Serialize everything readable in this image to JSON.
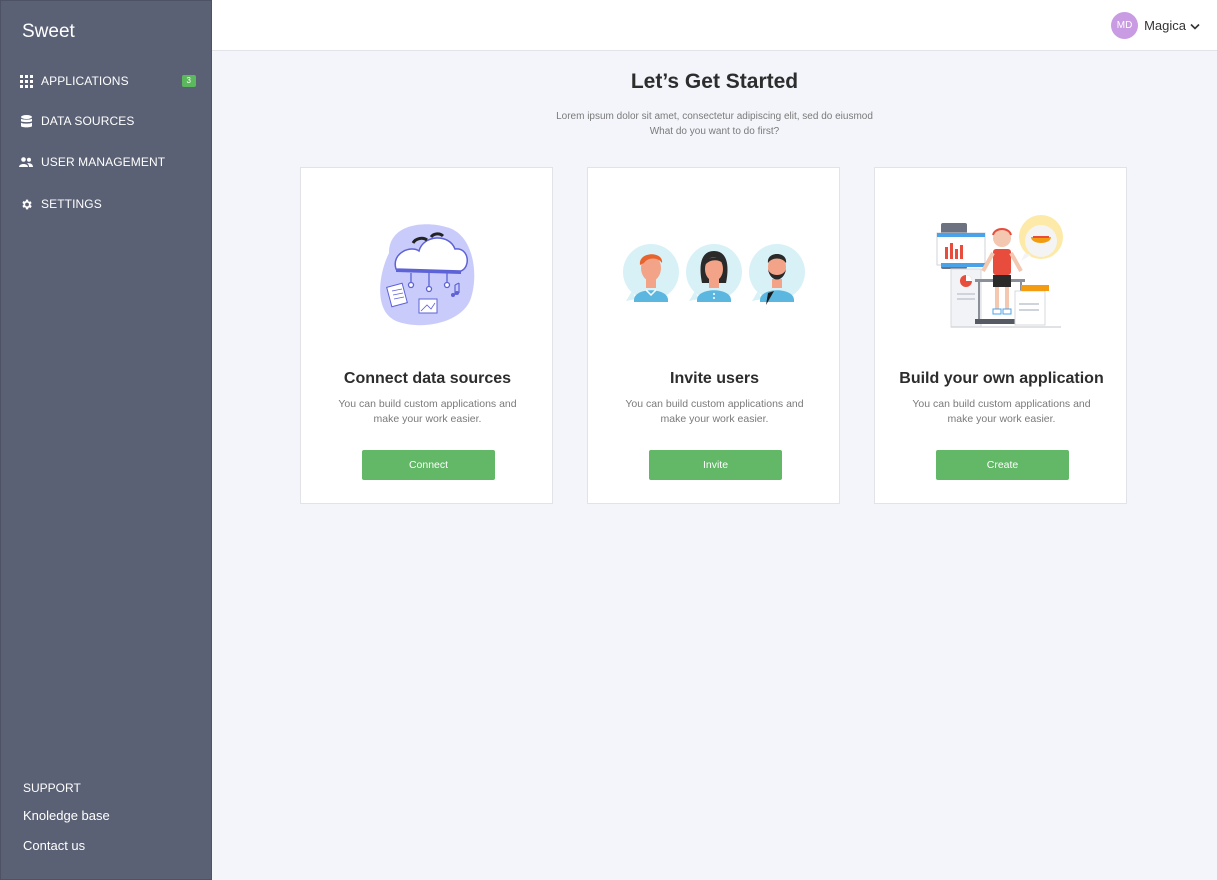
{
  "app": {
    "brand": "Sweet"
  },
  "sidebar": {
    "items": [
      {
        "label": "APPLICATIONS",
        "icon": "grid-icon",
        "badge": "3"
      },
      {
        "label": "DATA SOURCES",
        "icon": "database-icon"
      },
      {
        "label": "USER MANAGEMENT",
        "icon": "users-icon"
      },
      {
        "label": "SETTINGS",
        "icon": "gear-icon"
      }
    ],
    "support": {
      "heading": "SUPPORT",
      "links": [
        "Knoledge base",
        "Contact us"
      ]
    }
  },
  "topbar": {
    "user": {
      "initials": "MD",
      "name": "Magica"
    }
  },
  "main": {
    "title": "Let’s Get Started",
    "subtitle_line1": "Lorem ipsum dolor sit amet, consectetur adipiscing elit, sed do eiusmod",
    "subtitle_line2": "What do you want to do first?",
    "cards": [
      {
        "title": "Connect data sources",
        "desc": "You can build custom applications and make your work easier.",
        "button": "Connect"
      },
      {
        "title": "Invite users",
        "desc": "You can build custom applications and make your work easier.",
        "button": "Invite"
      },
      {
        "title": "Build your own application",
        "desc": "You can build custom applications and make your work easier.",
        "button": "Create"
      }
    ]
  },
  "colors": {
    "sidebar": "#5b6175",
    "accent": "#62b866",
    "badge": "#5cb85c",
    "avatar": "#c89be3",
    "background": "#f3f5fa"
  }
}
